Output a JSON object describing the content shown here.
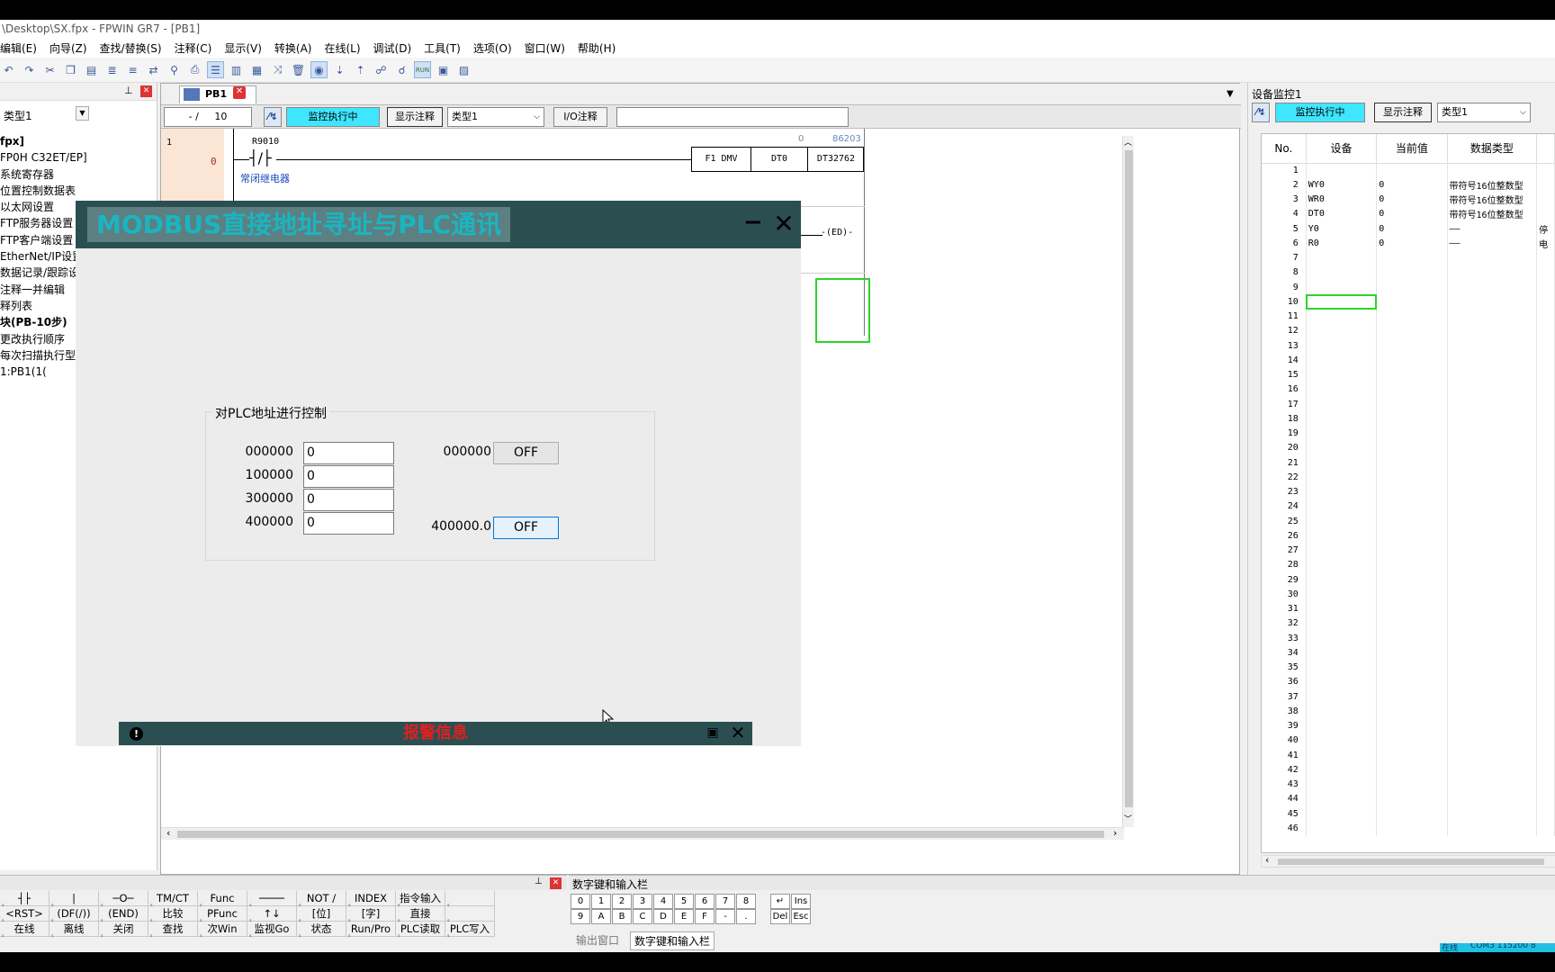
{
  "window": {
    "title": "\\Desktop\\SX.fpx - FPWIN GR7 - [PB1]"
  },
  "menu": [
    "编辑(E)",
    "向导(Z)",
    "查找/替换(S)",
    "注释(C)",
    "显示(V)",
    "转换(A)",
    "在线(L)",
    "调试(D)",
    "工具(T)",
    "选项(O)",
    "窗口(W)",
    "帮助(H)"
  ],
  "left_panel": {
    "type_select": "类型1",
    "tree": [
      {
        "label": "fpx]",
        "bold": true
      },
      {
        "label": "FP0H C32ET/EP]"
      },
      {
        "label": "系统寄存器"
      },
      {
        "label": "位置控制数据表"
      },
      {
        "label": "以太网设置"
      },
      {
        "label": "FTP服务器设置"
      },
      {
        "label": "FTP客户端设置"
      },
      {
        "label": "EtherNet/IP设置"
      },
      {
        "label": "数据记录/跟踪设"
      },
      {
        "label": "注释一并编辑"
      },
      {
        "label": "释列表"
      },
      {
        "label": "块(PB-10步)",
        "bold": true
      },
      {
        "label": "更改执行顺序"
      },
      {
        "label": "每次扫描执行型"
      },
      {
        "label": "1:PB1(1("
      }
    ]
  },
  "editor": {
    "tab": "PB1",
    "step_field": "- /",
    "step_total": "10",
    "monitor_status": "监控执行中",
    "show_comment": "显示注释",
    "type_select": "类型1",
    "io_comment": "I/O注释",
    "ladder": {
      "row_no": "1",
      "step_no": "0",
      "contact": "R9010",
      "contact_comment": "常闭继电器",
      "instr": "F1 DMV",
      "op1": "DT0",
      "op2": "DT32762",
      "val1": "0",
      "val2": "86203",
      "end_label": "ED"
    }
  },
  "monitor": {
    "title": "设备监控1",
    "status": "监控执行中",
    "show_comment": "显示注释",
    "type_select": "类型1",
    "headers": [
      "No.",
      "设备",
      "当前值",
      "数据类型"
    ],
    "rows": [
      {
        "no": "1",
        "dev": "",
        "val": "",
        "type": "",
        "extra": ""
      },
      {
        "no": "2",
        "dev": "WY0",
        "val": "0",
        "type": "带符号16位整数型",
        "extra": ""
      },
      {
        "no": "3",
        "dev": "WR0",
        "val": "0",
        "type": "带符号16位整数型",
        "extra": ""
      },
      {
        "no": "4",
        "dev": "DT0",
        "val": "0",
        "type": "带符号16位整数型",
        "extra": ""
      },
      {
        "no": "5",
        "dev": "Y0",
        "val": "0",
        "type": "——",
        "extra": "停"
      },
      {
        "no": "6",
        "dev": "R0",
        "val": "0",
        "type": "——",
        "extra": "电"
      },
      {
        "no": "7"
      },
      {
        "no": "8"
      },
      {
        "no": "9"
      },
      {
        "no": "10"
      },
      {
        "no": "11"
      },
      {
        "no": "12"
      },
      {
        "no": "13"
      },
      {
        "no": "14"
      },
      {
        "no": "15"
      },
      {
        "no": "16"
      },
      {
        "no": "17"
      },
      {
        "no": "18"
      },
      {
        "no": "19"
      },
      {
        "no": "20"
      },
      {
        "no": "21"
      },
      {
        "no": "22"
      },
      {
        "no": "23"
      },
      {
        "no": "24"
      },
      {
        "no": "25"
      },
      {
        "no": "26"
      },
      {
        "no": "27"
      },
      {
        "no": "28"
      },
      {
        "no": "29"
      },
      {
        "no": "30"
      },
      {
        "no": "31"
      },
      {
        "no": "32"
      },
      {
        "no": "33"
      },
      {
        "no": "34"
      },
      {
        "no": "35"
      },
      {
        "no": "36"
      },
      {
        "no": "37"
      },
      {
        "no": "38"
      },
      {
        "no": "39"
      },
      {
        "no": "40"
      },
      {
        "no": "41"
      },
      {
        "no": "42"
      },
      {
        "no": "43"
      },
      {
        "no": "44"
      },
      {
        "no": "45"
      },
      {
        "no": "46"
      }
    ]
  },
  "function_keys": {
    "row1": [
      "┤├",
      "|",
      "─O─",
      "TM/CT",
      "Func",
      "────",
      "NOT /",
      "INDEX",
      "指令输入",
      ""
    ],
    "row2": [
      "<RST>",
      "(DF(/))",
      "(END)",
      "比较",
      "PFunc",
      "↑↓",
      "[位]",
      "[字]",
      "直接",
      ""
    ],
    "row3": [
      "在线",
      "离线",
      "关闭",
      "查找",
      "次Win",
      "监视Go",
      "状态",
      "Run/Pro",
      "PLC读取",
      "PLC写入"
    ]
  },
  "numpad": {
    "title": "数字键和输入栏",
    "row1": [
      "0",
      "1",
      "2",
      "3",
      "4",
      "5",
      "6",
      "7",
      "8"
    ],
    "row2": [
      "9",
      "A",
      "B",
      "C",
      "D",
      "E",
      "F",
      "-",
      "."
    ],
    "side_top": [
      "↵",
      "Ins"
    ],
    "side_bottom": [
      "Del",
      "Esc"
    ],
    "tabs": [
      "输出窗口",
      "数字键和输入栏"
    ]
  },
  "overlay": {
    "title": "MODBUS直接地址寻址与PLC通讯",
    "group_title": "对PLC地址进行控制",
    "rows": [
      {
        "label": "000000",
        "value": "0"
      },
      {
        "label": "100000",
        "value": "0"
      },
      {
        "label": "300000",
        "value": "0"
      },
      {
        "label": "400000",
        "value": "0"
      }
    ],
    "coil_label_1": "000000",
    "coil_btn_1": "OFF",
    "coil_label_2": "400000.0",
    "coil_btn_2": "OFF",
    "alarm": "报警信息"
  },
  "status_bar": {
    "online": "在线",
    "port": "COM3 115200 8"
  },
  "colors": {
    "accent_cyan": "#3fe6ff",
    "overlay_header": "#2b4f51",
    "overlay_title_text": "#1ab5c0",
    "alarm_text": "#e02020",
    "selection_green": "#2cd32c"
  }
}
